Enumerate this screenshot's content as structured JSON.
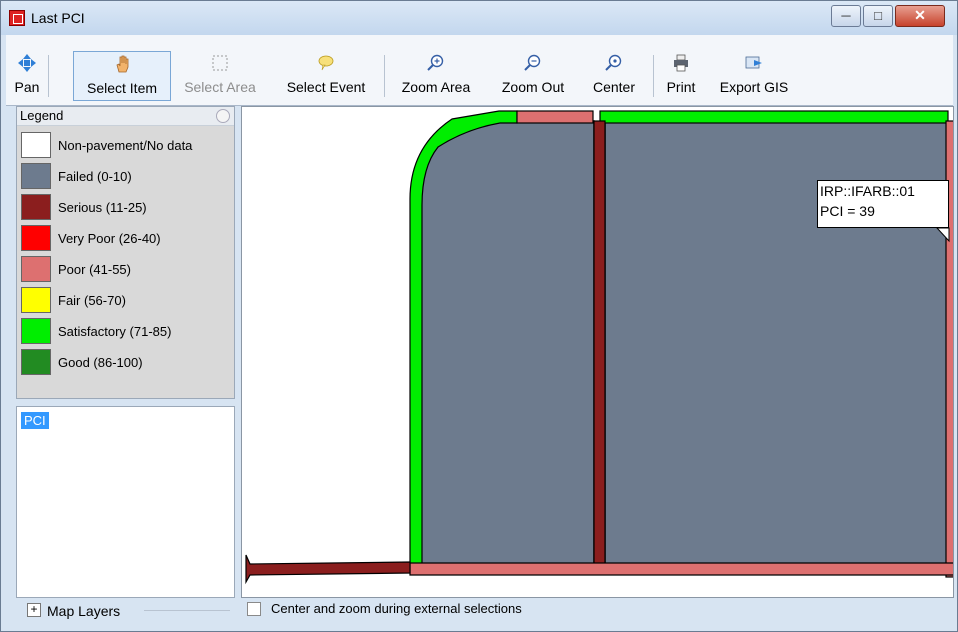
{
  "window": {
    "title": "Last PCI",
    "controls": {
      "minimize": "─",
      "maximize": "□",
      "close": "✕"
    }
  },
  "toolbar": {
    "tools": [
      {
        "label": "Pan",
        "icon": "pan-icon"
      },
      {
        "label": "Select Item",
        "icon": "hand-icon",
        "selected": true
      },
      {
        "label": "Select Area",
        "icon": "select-area-icon",
        "disabled": true
      },
      {
        "label": "Select Event",
        "icon": "speech-bubble-icon"
      },
      {
        "label": "Zoom Area",
        "icon": "zoom-in-icon"
      },
      {
        "label": "Zoom Out",
        "icon": "zoom-out-icon"
      },
      {
        "label": "Center",
        "icon": "zoom-center-icon"
      },
      {
        "label": "Print",
        "icon": "printer-icon"
      },
      {
        "label": "Export GIS",
        "icon": "export-icon"
      }
    ]
  },
  "legend": {
    "title": "Legend",
    "items": [
      {
        "label": "Non-pavement/No data",
        "color": "#ffffff"
      },
      {
        "label": "Failed (0-10)",
        "color": "#6d7b8e"
      },
      {
        "label": "Serious (11-25)",
        "color": "#8b1e1e"
      },
      {
        "label": "Very Poor (26-40)",
        "color": "#ff0000"
      },
      {
        "label": "Poor (41-55)",
        "color": "#dd7070"
      },
      {
        "label": "Fair (56-70)",
        "color": "#ffff00"
      },
      {
        "label": "Satisfactory (71-85)",
        "color": "#00ee00"
      },
      {
        "label": "Good (86-100)",
        "color": "#228b22"
      }
    ]
  },
  "layers": {
    "selected": "PCI",
    "expander": "+",
    "label": "Map Layers"
  },
  "map": {
    "tooltip": {
      "line1": "IRP::IFARB::01",
      "line2": "PCI = 39"
    }
  },
  "status": {
    "checkbox_label": "Center and zoom during external selections",
    "checked": false
  }
}
